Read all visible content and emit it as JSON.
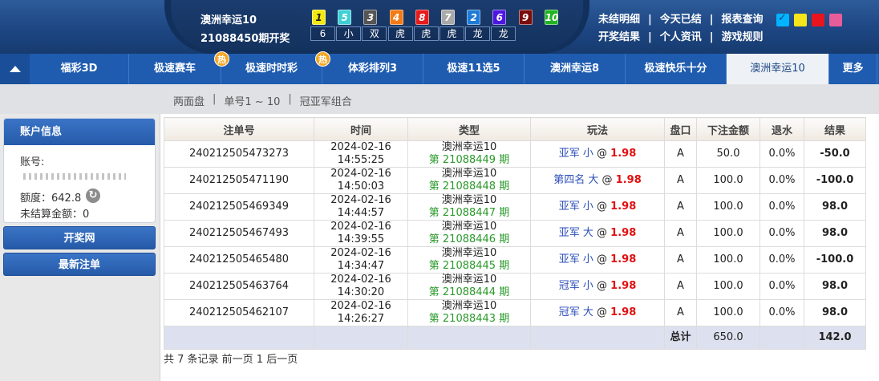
{
  "header": {
    "game_name": "澳洲幸运10",
    "issue_text": "21088450期开奖",
    "balls": [
      {
        "num": "1",
        "tag": "6",
        "bg": "#f5e90f",
        "fg": "#222"
      },
      {
        "num": "5",
        "tag": "小",
        "bg": "#3fd0d6",
        "fg": "#fff"
      },
      {
        "num": "3",
        "tag": "双",
        "bg": "#555555",
        "fg": "#fff"
      },
      {
        "num": "4",
        "tag": "虎",
        "bg": "#f47a16",
        "fg": "#fff"
      },
      {
        "num": "8",
        "tag": "虎",
        "bg": "#e61b1b",
        "fg": "#fff"
      },
      {
        "num": "7",
        "tag": "虎",
        "bg": "#a9a9a9",
        "fg": "#fff"
      },
      {
        "num": "2",
        "tag": "龙",
        "bg": "#1f7ad6",
        "fg": "#fff"
      },
      {
        "num": "6",
        "tag": "龙",
        "bg": "#4c17e0",
        "fg": "#fff"
      },
      {
        "num": "9",
        "tag": "",
        "bg": "#7a0c0c",
        "fg": "#fff"
      },
      {
        "num": "10",
        "tag": "",
        "bg": "#22b422",
        "fg": "#fff"
      }
    ],
    "links_row1": [
      "未结明细",
      "今天已结",
      "报表查询"
    ],
    "links_row2": [
      "开奖结果",
      "个人资讯",
      "游戏规则"
    ],
    "skins": [
      "#00b4ff",
      "#f5e51a",
      "#e8141e",
      "#e65d9a"
    ]
  },
  "nav": {
    "tabs": [
      {
        "label": "福彩3D",
        "width": 124,
        "hot": false
      },
      {
        "label": "极速赛车",
        "width": 115,
        "hot": true
      },
      {
        "label": "极速时时彩",
        "width": 126,
        "hot": true
      },
      {
        "label": "体彩排列3",
        "width": 126,
        "hot": false
      },
      {
        "label": "极速11选5",
        "width": 126,
        "hot": false
      },
      {
        "label": "澳洲幸运8",
        "width": 126,
        "hot": false
      },
      {
        "label": "极速快乐十分",
        "width": 126,
        "hot": false
      },
      {
        "label": "澳洲幸运10",
        "width": 128,
        "hot": false,
        "active": true
      },
      {
        "label": "更多",
        "width": 60,
        "hot": false
      }
    ],
    "hot_label": "热"
  },
  "subbar": {
    "crumbs": [
      "两面盘",
      "单号1 ~ 10",
      "冠亚军组合"
    ]
  },
  "sidebar": {
    "title": "账户信息",
    "account_label": "账号:",
    "quota": "额度：642.8",
    "unsettled": "未结算金额：0",
    "btn_draw": "开奖网",
    "btn_latest": "最新注单"
  },
  "table": {
    "headers": [
      "注单号",
      "时间",
      "类型",
      "玩法",
      "盘口",
      "下注金额",
      "退水",
      "结果"
    ],
    "rows": [
      {
        "id": "240212505473273",
        "date": "2024-02-16",
        "time": "14:55:25",
        "game": "澳洲幸运10",
        "issue": "第 21088449 期",
        "play": "亚军 小",
        "odds": "1.98",
        "pankou": "A",
        "amount": "50.0",
        "rebate": "0.0%",
        "result": "-50.0",
        "win": false
      },
      {
        "id": "240212505471190",
        "date": "2024-02-16",
        "time": "14:50:03",
        "game": "澳洲幸运10",
        "issue": "第 21088448 期",
        "play": "第四名 大",
        "odds": "1.98",
        "pankou": "A",
        "amount": "100.0",
        "rebate": "0.0%",
        "result": "-100.0",
        "win": false
      },
      {
        "id": "240212505469349",
        "date": "2024-02-16",
        "time": "14:44:57",
        "game": "澳洲幸运10",
        "issue": "第 21088447 期",
        "play": "亚军 小",
        "odds": "1.98",
        "pankou": "A",
        "amount": "100.0",
        "rebate": "0.0%",
        "result": "98.0",
        "win": true
      },
      {
        "id": "240212505467493",
        "date": "2024-02-16",
        "time": "14:39:55",
        "game": "澳洲幸运10",
        "issue": "第 21088446 期",
        "play": "亚军 大",
        "odds": "1.98",
        "pankou": "A",
        "amount": "100.0",
        "rebate": "0.0%",
        "result": "98.0",
        "win": true
      },
      {
        "id": "240212505465480",
        "date": "2024-02-16",
        "time": "14:34:47",
        "game": "澳洲幸运10",
        "issue": "第 21088445 期",
        "play": "亚军 小",
        "odds": "1.98",
        "pankou": "A",
        "amount": "100.0",
        "rebate": "0.0%",
        "result": "-100.0",
        "win": false
      },
      {
        "id": "240212505463764",
        "date": "2024-02-16",
        "time": "14:30:20",
        "game": "澳洲幸运10",
        "issue": "第 21088444 期",
        "play": "冠军 小",
        "odds": "1.98",
        "pankou": "A",
        "amount": "100.0",
        "rebate": "0.0%",
        "result": "98.0",
        "win": true
      },
      {
        "id": "240212505462107",
        "date": "2024-02-16",
        "time": "14:26:27",
        "game": "澳洲幸运10",
        "issue": "第 21088443 期",
        "play": "冠军 大",
        "odds": "1.98",
        "pankou": "A",
        "amount": "100.0",
        "rebate": "0.0%",
        "result": "98.0",
        "win": true
      }
    ],
    "total_label": "总计",
    "total_amount": "650.0",
    "total_result": "142.0",
    "odds_prefix": "@"
  },
  "pager": "共 7 条记录 前一页 1 后一页"
}
